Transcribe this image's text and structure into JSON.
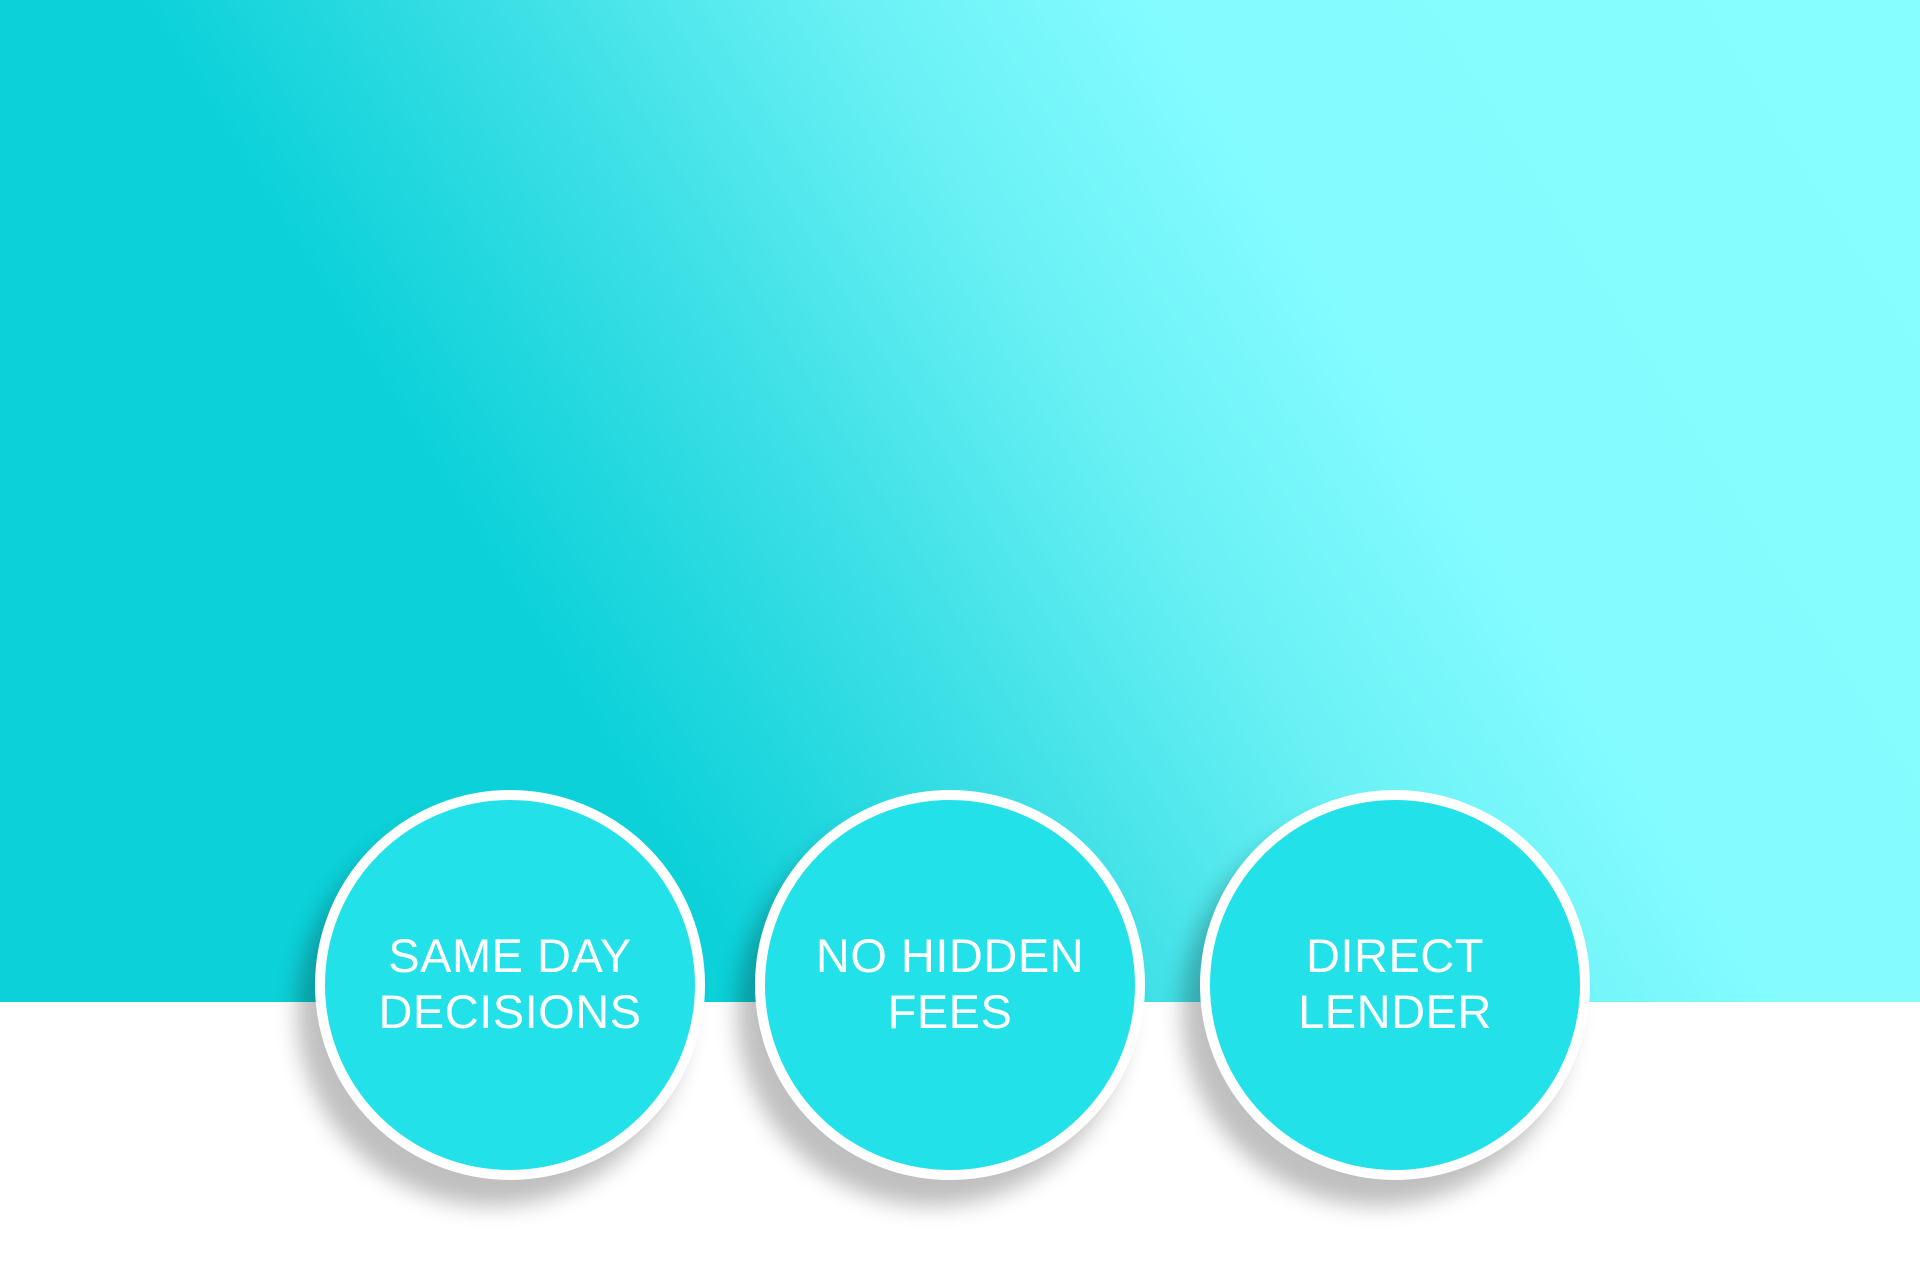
{
  "colors": {
    "gradient_dark": "#0cd1d9",
    "gradient_light": "#86feff",
    "badge_fill": "#22e1e8",
    "badge_border": "#ffffff",
    "text": "#ffffff",
    "background": "#ffffff"
  },
  "badges": [
    {
      "label": "SAME DAY\nDECISIONS"
    },
    {
      "label": "NO HIDDEN\nFEES"
    },
    {
      "label": "DIRECT\nLENDER"
    }
  ]
}
